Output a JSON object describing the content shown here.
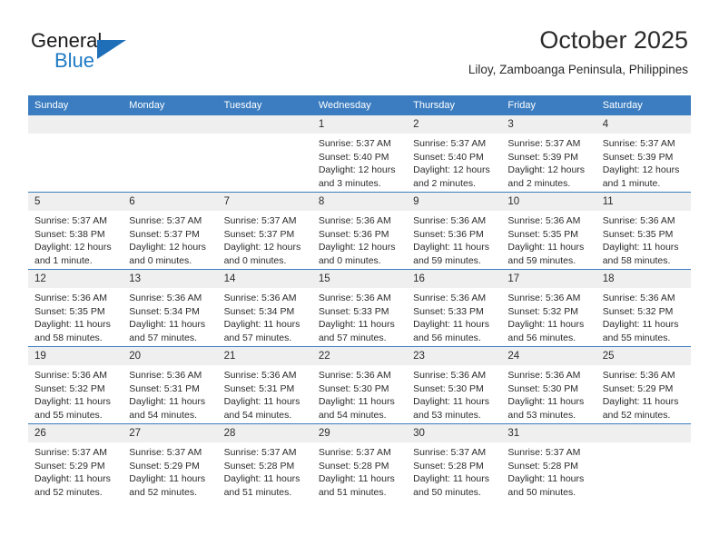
{
  "brand": {
    "word1": "General",
    "word2": "Blue",
    "accent_color": "#1f7ac4"
  },
  "header": {
    "title": "October 2025",
    "subtitle": "Liloy, Zamboanga Peninsula, Philippines"
  },
  "calendar": {
    "header_color": "#3b7dc0",
    "weekdays": [
      "Sunday",
      "Monday",
      "Tuesday",
      "Wednesday",
      "Thursday",
      "Friday",
      "Saturday"
    ],
    "labels": {
      "sunrise": "Sunrise:",
      "sunset": "Sunset:",
      "daylight": "Daylight:"
    },
    "weeks": [
      [
        {
          "day": "",
          "sunrise": "",
          "sunset": "",
          "daylight_line1": "",
          "daylight_line2": ""
        },
        {
          "day": "",
          "sunrise": "",
          "sunset": "",
          "daylight_line1": "",
          "daylight_line2": ""
        },
        {
          "day": "",
          "sunrise": "",
          "sunset": "",
          "daylight_line1": "",
          "daylight_line2": ""
        },
        {
          "day": "1",
          "sunrise": "Sunrise: 5:37 AM",
          "sunset": "Sunset: 5:40 PM",
          "daylight_line1": "Daylight: 12 hours",
          "daylight_line2": "and 3 minutes."
        },
        {
          "day": "2",
          "sunrise": "Sunrise: 5:37 AM",
          "sunset": "Sunset: 5:40 PM",
          "daylight_line1": "Daylight: 12 hours",
          "daylight_line2": "and 2 minutes."
        },
        {
          "day": "3",
          "sunrise": "Sunrise: 5:37 AM",
          "sunset": "Sunset: 5:39 PM",
          "daylight_line1": "Daylight: 12 hours",
          "daylight_line2": "and 2 minutes."
        },
        {
          "day": "4",
          "sunrise": "Sunrise: 5:37 AM",
          "sunset": "Sunset: 5:39 PM",
          "daylight_line1": "Daylight: 12 hours",
          "daylight_line2": "and 1 minute."
        }
      ],
      [
        {
          "day": "5",
          "sunrise": "Sunrise: 5:37 AM",
          "sunset": "Sunset: 5:38 PM",
          "daylight_line1": "Daylight: 12 hours",
          "daylight_line2": "and 1 minute."
        },
        {
          "day": "6",
          "sunrise": "Sunrise: 5:37 AM",
          "sunset": "Sunset: 5:37 PM",
          "daylight_line1": "Daylight: 12 hours",
          "daylight_line2": "and 0 minutes."
        },
        {
          "day": "7",
          "sunrise": "Sunrise: 5:37 AM",
          "sunset": "Sunset: 5:37 PM",
          "daylight_line1": "Daylight: 12 hours",
          "daylight_line2": "and 0 minutes."
        },
        {
          "day": "8",
          "sunrise": "Sunrise: 5:36 AM",
          "sunset": "Sunset: 5:36 PM",
          "daylight_line1": "Daylight: 12 hours",
          "daylight_line2": "and 0 minutes."
        },
        {
          "day": "9",
          "sunrise": "Sunrise: 5:36 AM",
          "sunset": "Sunset: 5:36 PM",
          "daylight_line1": "Daylight: 11 hours",
          "daylight_line2": "and 59 minutes."
        },
        {
          "day": "10",
          "sunrise": "Sunrise: 5:36 AM",
          "sunset": "Sunset: 5:35 PM",
          "daylight_line1": "Daylight: 11 hours",
          "daylight_line2": "and 59 minutes."
        },
        {
          "day": "11",
          "sunrise": "Sunrise: 5:36 AM",
          "sunset": "Sunset: 5:35 PM",
          "daylight_line1": "Daylight: 11 hours",
          "daylight_line2": "and 58 minutes."
        }
      ],
      [
        {
          "day": "12",
          "sunrise": "Sunrise: 5:36 AM",
          "sunset": "Sunset: 5:35 PM",
          "daylight_line1": "Daylight: 11 hours",
          "daylight_line2": "and 58 minutes."
        },
        {
          "day": "13",
          "sunrise": "Sunrise: 5:36 AM",
          "sunset": "Sunset: 5:34 PM",
          "daylight_line1": "Daylight: 11 hours",
          "daylight_line2": "and 57 minutes."
        },
        {
          "day": "14",
          "sunrise": "Sunrise: 5:36 AM",
          "sunset": "Sunset: 5:34 PM",
          "daylight_line1": "Daylight: 11 hours",
          "daylight_line2": "and 57 minutes."
        },
        {
          "day": "15",
          "sunrise": "Sunrise: 5:36 AM",
          "sunset": "Sunset: 5:33 PM",
          "daylight_line1": "Daylight: 11 hours",
          "daylight_line2": "and 57 minutes."
        },
        {
          "day": "16",
          "sunrise": "Sunrise: 5:36 AM",
          "sunset": "Sunset: 5:33 PM",
          "daylight_line1": "Daylight: 11 hours",
          "daylight_line2": "and 56 minutes."
        },
        {
          "day": "17",
          "sunrise": "Sunrise: 5:36 AM",
          "sunset": "Sunset: 5:32 PM",
          "daylight_line1": "Daylight: 11 hours",
          "daylight_line2": "and 56 minutes."
        },
        {
          "day": "18",
          "sunrise": "Sunrise: 5:36 AM",
          "sunset": "Sunset: 5:32 PM",
          "daylight_line1": "Daylight: 11 hours",
          "daylight_line2": "and 55 minutes."
        }
      ],
      [
        {
          "day": "19",
          "sunrise": "Sunrise: 5:36 AM",
          "sunset": "Sunset: 5:32 PM",
          "daylight_line1": "Daylight: 11 hours",
          "daylight_line2": "and 55 minutes."
        },
        {
          "day": "20",
          "sunrise": "Sunrise: 5:36 AM",
          "sunset": "Sunset: 5:31 PM",
          "daylight_line1": "Daylight: 11 hours",
          "daylight_line2": "and 54 minutes."
        },
        {
          "day": "21",
          "sunrise": "Sunrise: 5:36 AM",
          "sunset": "Sunset: 5:31 PM",
          "daylight_line1": "Daylight: 11 hours",
          "daylight_line2": "and 54 minutes."
        },
        {
          "day": "22",
          "sunrise": "Sunrise: 5:36 AM",
          "sunset": "Sunset: 5:30 PM",
          "daylight_line1": "Daylight: 11 hours",
          "daylight_line2": "and 54 minutes."
        },
        {
          "day": "23",
          "sunrise": "Sunrise: 5:36 AM",
          "sunset": "Sunset: 5:30 PM",
          "daylight_line1": "Daylight: 11 hours",
          "daylight_line2": "and 53 minutes."
        },
        {
          "day": "24",
          "sunrise": "Sunrise: 5:36 AM",
          "sunset": "Sunset: 5:30 PM",
          "daylight_line1": "Daylight: 11 hours",
          "daylight_line2": "and 53 minutes."
        },
        {
          "day": "25",
          "sunrise": "Sunrise: 5:36 AM",
          "sunset": "Sunset: 5:29 PM",
          "daylight_line1": "Daylight: 11 hours",
          "daylight_line2": "and 52 minutes."
        }
      ],
      [
        {
          "day": "26",
          "sunrise": "Sunrise: 5:37 AM",
          "sunset": "Sunset: 5:29 PM",
          "daylight_line1": "Daylight: 11 hours",
          "daylight_line2": "and 52 minutes."
        },
        {
          "day": "27",
          "sunrise": "Sunrise: 5:37 AM",
          "sunset": "Sunset: 5:29 PM",
          "daylight_line1": "Daylight: 11 hours",
          "daylight_line2": "and 52 minutes."
        },
        {
          "day": "28",
          "sunrise": "Sunrise: 5:37 AM",
          "sunset": "Sunset: 5:28 PM",
          "daylight_line1": "Daylight: 11 hours",
          "daylight_line2": "and 51 minutes."
        },
        {
          "day": "29",
          "sunrise": "Sunrise: 5:37 AM",
          "sunset": "Sunset: 5:28 PM",
          "daylight_line1": "Daylight: 11 hours",
          "daylight_line2": "and 51 minutes."
        },
        {
          "day": "30",
          "sunrise": "Sunrise: 5:37 AM",
          "sunset": "Sunset: 5:28 PM",
          "daylight_line1": "Daylight: 11 hours",
          "daylight_line2": "and 50 minutes."
        },
        {
          "day": "31",
          "sunrise": "Sunrise: 5:37 AM",
          "sunset": "Sunset: 5:28 PM",
          "daylight_line1": "Daylight: 11 hours",
          "daylight_line2": "and 50 minutes."
        },
        {
          "day": "",
          "sunrise": "",
          "sunset": "",
          "daylight_line1": "",
          "daylight_line2": ""
        }
      ]
    ]
  }
}
